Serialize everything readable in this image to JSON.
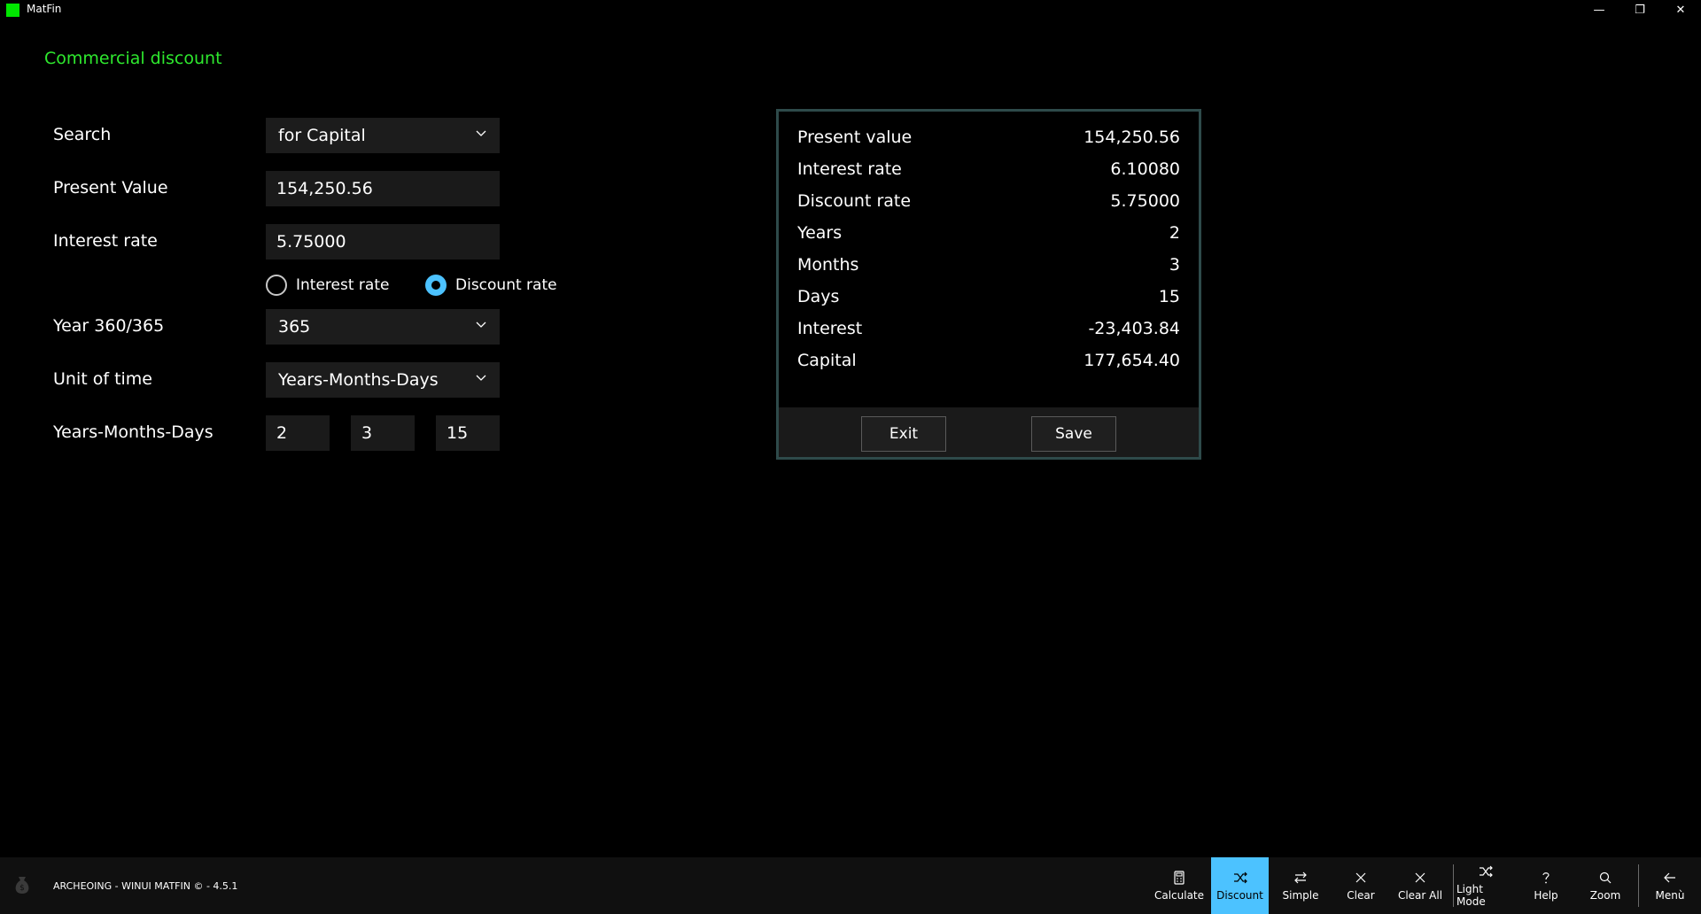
{
  "window": {
    "title": "MatFin",
    "brand_color": "#00e600",
    "controls": {
      "minimize": "—",
      "restore": "❐",
      "close": "✕"
    }
  },
  "page": {
    "title": "Commercial discount",
    "title_color": "#2ee82e"
  },
  "form": {
    "search": {
      "label": "Search",
      "value": "for Capital"
    },
    "present_value": {
      "label": "Present Value",
      "value": "154,250.56"
    },
    "rate": {
      "label": "Interest rate",
      "value": "5.75000"
    },
    "rate_type": {
      "options": [
        {
          "label": "Interest rate",
          "checked": false
        },
        {
          "label": "Discount rate",
          "checked": true
        }
      ]
    },
    "year_basis": {
      "label": "Year 360/365",
      "value": "365"
    },
    "unit_of_time": {
      "label": "Unit of time",
      "value": "Years-Months-Days"
    },
    "duration": {
      "label": "Years-Months-Days",
      "years": "2",
      "months": "3",
      "days": "15"
    }
  },
  "result": {
    "rows": [
      {
        "label": "Present value",
        "value": "154,250.56"
      },
      {
        "label": "Interest rate",
        "value": "6.10080"
      },
      {
        "label": "Discount rate",
        "value": "5.75000"
      },
      {
        "label": "Years",
        "value": "2"
      },
      {
        "label": "Months",
        "value": "3"
      },
      {
        "label": "Days",
        "value": "15"
      },
      {
        "label": "Interest",
        "value": "-23,403.84"
      },
      {
        "label": "Capital",
        "value": "177,654.40"
      }
    ],
    "exit_label": "Exit",
    "save_label": "Save"
  },
  "footer": {
    "text": "ARCHEOING - WINUI MATFIN © - 4.5.1",
    "commands": [
      {
        "label": "Calculate",
        "icon": "calculator-icon",
        "active": false
      },
      {
        "label": "Discount",
        "icon": "shuffle-icon",
        "active": true
      },
      {
        "label": "Simple",
        "icon": "swap-icon",
        "active": false
      },
      {
        "label": "Clear",
        "icon": "close-icon",
        "active": false
      },
      {
        "label": "Clear All",
        "icon": "close-icon",
        "active": false
      },
      {
        "label": "Light Mode",
        "icon": "shuffle-icon",
        "active": false
      },
      {
        "label": "Help",
        "icon": "question-icon",
        "active": false
      },
      {
        "label": "Zoom",
        "icon": "search-icon",
        "active": false
      },
      {
        "label": "Menù",
        "icon": "back-arrow-icon",
        "active": false
      }
    ],
    "accent_color": "#4cc2ff"
  }
}
